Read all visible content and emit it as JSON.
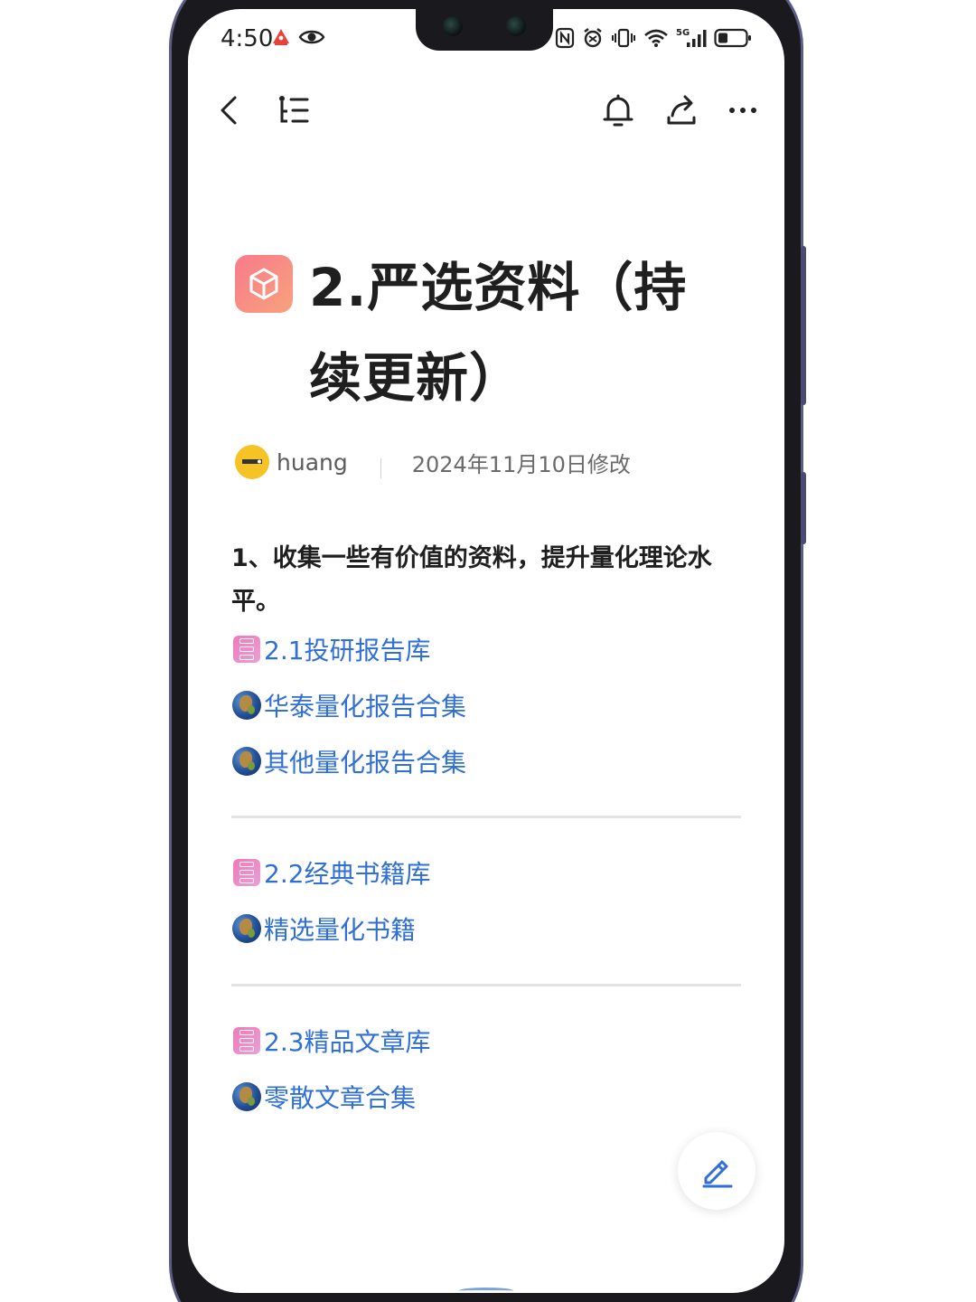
{
  "status_bar": {
    "time": "4:50",
    "left_icons": [
      "alert-app-icon",
      "eye-icon"
    ],
    "right_icons": [
      "nfc-icon",
      "alarm-icon",
      "vibrate-icon",
      "wifi-icon",
      "signal-5g-icon",
      "battery-icon"
    ],
    "network": "5G"
  },
  "toolbar": {
    "icons": [
      "back-icon",
      "outline-icon",
      "bell-icon",
      "share-icon",
      "more-icon"
    ]
  },
  "doc": {
    "title": "2.严选资料（持续更新）",
    "title_icon": "cube-icon",
    "author": "huang",
    "modified": "2024年11月10日修改",
    "intro": "1、收集一些有价值的资料，提升量化理论水平。"
  },
  "sections": [
    {
      "items": [
        {
          "type": "database",
          "label": "2.1投研报告库"
        },
        {
          "type": "globe",
          "label": "华泰量化报告合集"
        },
        {
          "type": "globe",
          "label": "其他量化报告合集"
        }
      ]
    },
    {
      "items": [
        {
          "type": "database",
          "label": "2.2经典书籍库"
        },
        {
          "type": "globe",
          "label": "精选量化书籍"
        }
      ]
    },
    {
      "items": [
        {
          "type": "database",
          "label": "2.3精品文章库"
        },
        {
          "type": "globe",
          "label": "零散文章合集"
        }
      ]
    }
  ],
  "fab": {
    "icon": "edit-pencil-icon"
  },
  "colors": {
    "link": "#2f6fd6",
    "title_icon_gradient": [
      "#f97a8c",
      "#f7a27c"
    ],
    "database_icon": "#f278b8",
    "fab_icon": "#2f6fd6"
  }
}
